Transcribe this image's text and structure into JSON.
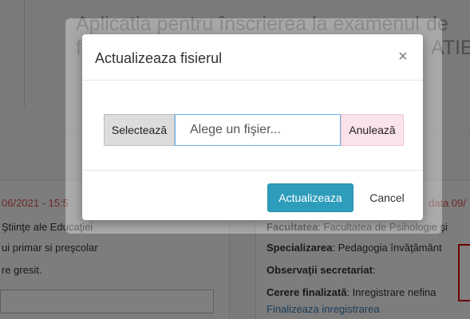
{
  "background": {
    "title_line1": "Aplicatia pentru înscrierea la examenul",
    "title_line1_right": "de",
    "title_line2_left": "f",
    "title_line2_right": "ATIE",
    "left_panel": {
      "date_text": "06/2021 - 15:5",
      "line1": "Ştiinţe ale Educaţiei",
      "line2": "ui primar si preşcolar",
      "line3": "re gresit."
    },
    "right_panel": {
      "date_text": "data 09/",
      "faculty_label": "Facultatea",
      "faculty_value": ": Facultatea de Psihologie şi",
      "spec_label": "Specializarea",
      "spec_value": ": Pedagogia învăţământ",
      "obs_label": "Observaţii secretariat",
      "obs_value": ":",
      "cerere_label": "Cerere finalizată",
      "cerere_value": ": Inregistrare nefina",
      "link": "Finalizeaza inregistrarea"
    }
  },
  "modal": {
    "title": "Actualizeaza fisierul",
    "close_glyph": "×",
    "select_label": "Selectează",
    "file_placeholder": "Alege un fişier...",
    "cancel_file_label": "Anulează",
    "update_label": "Actualizeaza",
    "cancel_label": "Cancel"
  }
}
